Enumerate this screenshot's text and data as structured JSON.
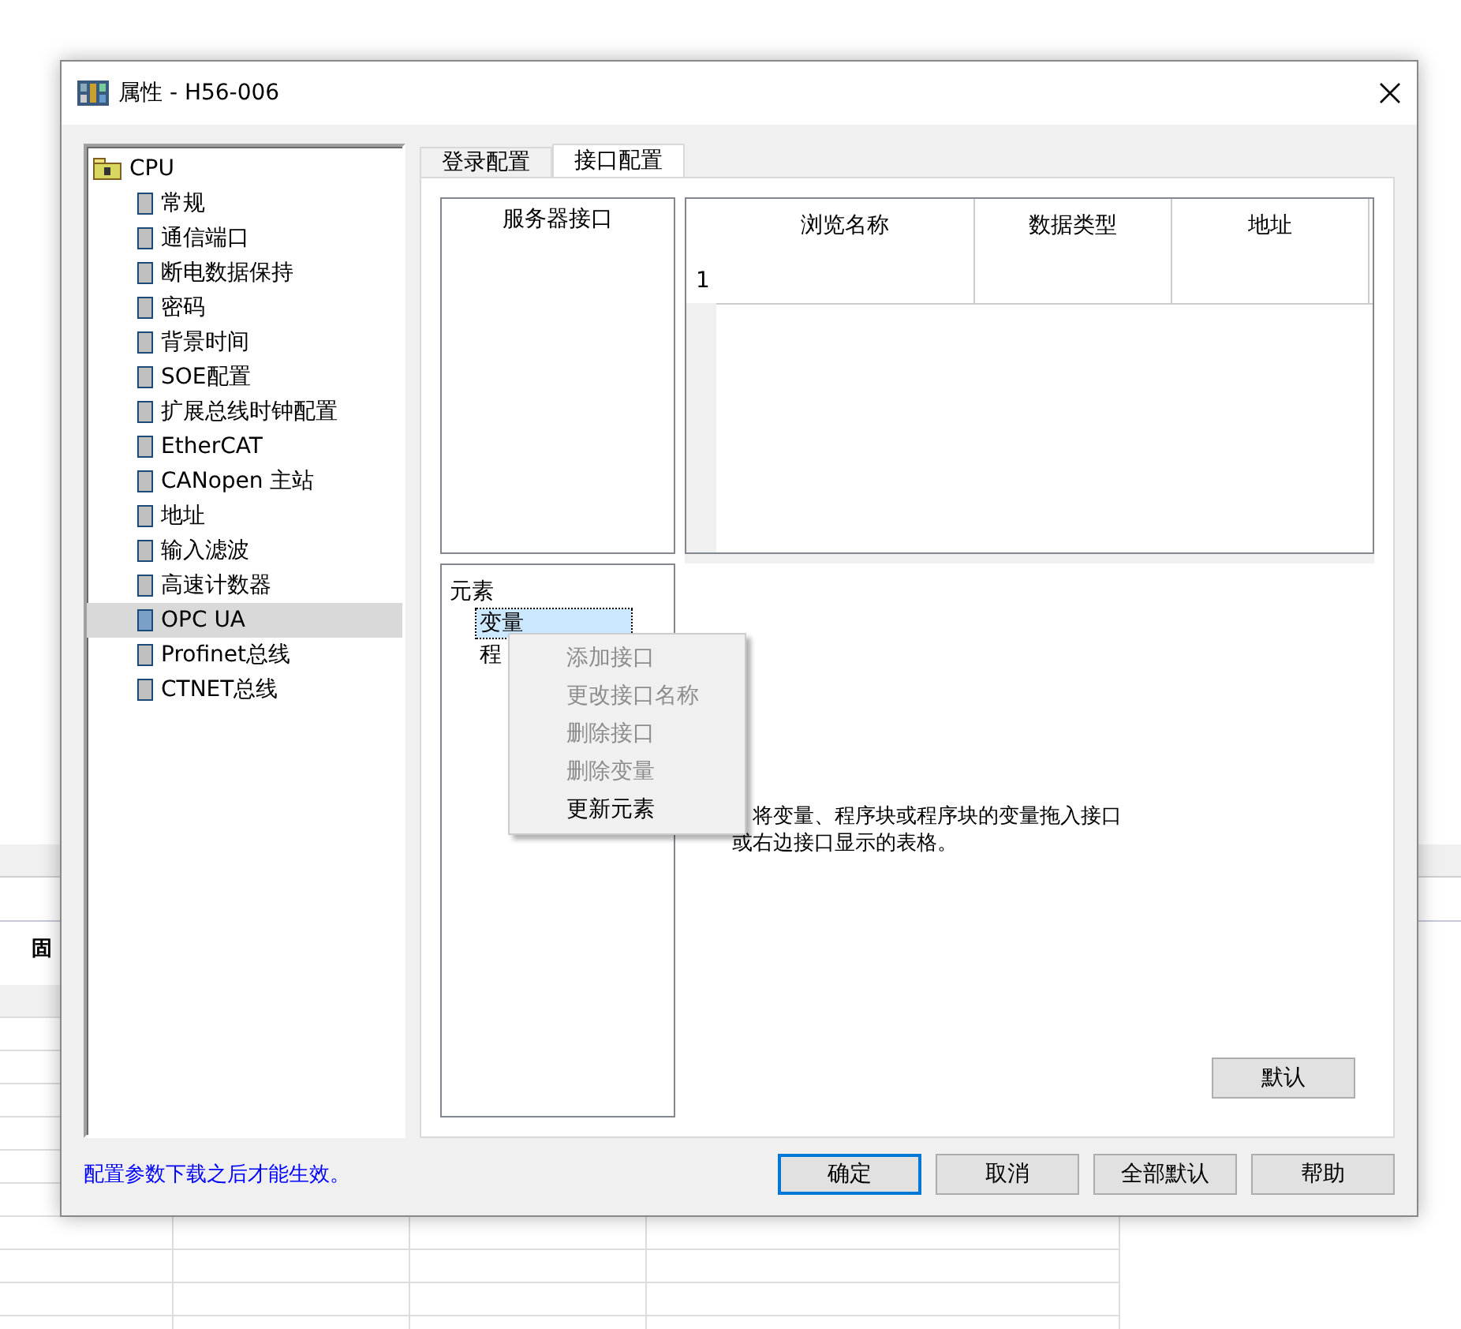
{
  "background": {
    "label": "固"
  },
  "window": {
    "title": "属性 - H56-006"
  },
  "sidebar": {
    "items": [
      {
        "label": "CPU",
        "kind": "folder",
        "selected": false,
        "children": [
          {
            "label": "常规",
            "kind": "module",
            "selected": false
          },
          {
            "label": "通信端口",
            "kind": "module",
            "selected": false
          },
          {
            "label": "断电数据保持",
            "kind": "module",
            "selected": false
          },
          {
            "label": "密码",
            "kind": "module",
            "selected": false
          },
          {
            "label": "背景时间",
            "kind": "module",
            "selected": false
          },
          {
            "label": "SOE配置",
            "kind": "module",
            "selected": false
          },
          {
            "label": "扩展总线时钟配置",
            "kind": "module",
            "selected": false
          },
          {
            "label": "EtherCAT",
            "kind": "module",
            "selected": false
          },
          {
            "label": "CANopen 主站",
            "kind": "module",
            "selected": false
          },
          {
            "label": "地址",
            "kind": "module",
            "selected": false
          },
          {
            "label": "输入滤波",
            "kind": "module",
            "selected": false
          },
          {
            "label": "高速计数器",
            "kind": "module",
            "selected": false
          },
          {
            "label": "OPC UA",
            "kind": "module",
            "selected": true
          },
          {
            "label": "Profinet总线",
            "kind": "module",
            "selected": false
          },
          {
            "label": "CTNET总线",
            "kind": "module",
            "selected": false
          }
        ]
      }
    ]
  },
  "tabs": [
    {
      "label": "登录配置",
      "selected": false
    },
    {
      "label": "接口配置",
      "selected": true
    }
  ],
  "server_list": {
    "title": "服务器接口"
  },
  "table": {
    "columns": [
      "浏览名称",
      "数据类型",
      "地址"
    ],
    "rows": [
      "1"
    ]
  },
  "elements": {
    "items": [
      {
        "label": "元素",
        "selected": false,
        "children": [
          {
            "label": "变量",
            "selected": true
          },
          {
            "label": "程",
            "selected": false
          }
        ]
      }
    ]
  },
  "hint": [
    "将变量、程序块或程序块的变量拖入接口",
    "或右边接口显示的表格。"
  ],
  "default_button": "默认",
  "context_menu": [
    {
      "label": "添加接口",
      "disabled": true
    },
    {
      "label": "更改接口名称",
      "disabled": true
    },
    {
      "label": "删除接口",
      "disabled": true
    },
    {
      "label": "删除变量",
      "disabled": true
    },
    {
      "label": "更新元素",
      "disabled": false
    }
  ],
  "note": "配置参数下载之后才能生效。",
  "buttons": [
    {
      "label": "确定",
      "selected": true
    },
    {
      "label": "取消",
      "selected": false
    },
    {
      "label": "全部默认",
      "selected": false
    },
    {
      "label": "帮助",
      "selected": false
    }
  ]
}
